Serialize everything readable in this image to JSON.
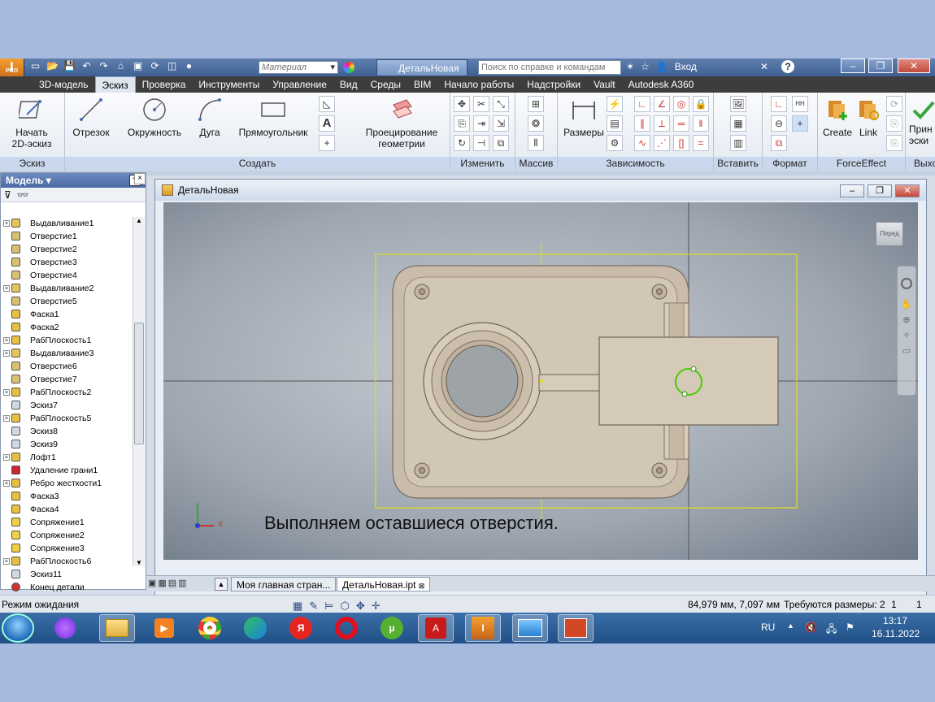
{
  "app": {
    "logo": "I",
    "logo_sub": "PRO"
  },
  "titlebar": {
    "material_placeholder": "Материал",
    "document_tab": "ДетальНовая",
    "search_placeholder": "Поиск по справке и командам",
    "login_label": "Вход"
  },
  "menu": {
    "tabs": [
      "3D-модель",
      "Эскиз",
      "Проверка",
      "Инструменты",
      "Управление",
      "Вид",
      "Среды",
      "BIM",
      "Начало работы",
      "Надстройки",
      "Vault",
      "Autodesk A360"
    ],
    "active_index": 1
  },
  "ribbon": {
    "start_sketch": {
      "line1": "Начать",
      "line2": "2D-эскиз"
    },
    "line": "Отрезок",
    "circle": "Окружность",
    "arc": "Дуга",
    "rectangle": "Прямоугольник",
    "project": {
      "line1": "Проецирование",
      "line2": "геометрии"
    },
    "dimension": "Размеры",
    "create": "Create",
    "link": "Link",
    "finish": {
      "line1": "Прин",
      "line2": "эски"
    },
    "panels": {
      "sketch": "Эскиз",
      "create": "Создать",
      "modify": "Изменить",
      "pattern": "Массив",
      "constrain": "Зависимость",
      "insert": "Вставить",
      "format": "Формат",
      "forceeffect": "ForceEffect",
      "exit": "Выхо"
    }
  },
  "browser": {
    "title": "Модель",
    "items": [
      {
        "label": "Выдавливание1",
        "icon": "extrude",
        "exp": true
      },
      {
        "label": "Отверстие1",
        "icon": "hole",
        "exp": false
      },
      {
        "label": "Отверстие2",
        "icon": "hole",
        "exp": false
      },
      {
        "label": "Отверстие3",
        "icon": "hole",
        "exp": false
      },
      {
        "label": "Отверстие4",
        "icon": "hole",
        "exp": false
      },
      {
        "label": "Выдавливание2",
        "icon": "extrude",
        "exp": true
      },
      {
        "label": "Отверстие5",
        "icon": "hole",
        "exp": false
      },
      {
        "label": "Фаска1",
        "icon": "chamfer",
        "exp": false
      },
      {
        "label": "Фаска2",
        "icon": "chamfer",
        "exp": false
      },
      {
        "label": "РабПлоскость1",
        "icon": "plane",
        "exp": true
      },
      {
        "label": "Выдавливание3",
        "icon": "extrude",
        "exp": true
      },
      {
        "label": "Отверстие6",
        "icon": "hole",
        "exp": false
      },
      {
        "label": "Отверстие7",
        "icon": "hole",
        "exp": false
      },
      {
        "label": "РабПлоскость2",
        "icon": "plane",
        "exp": true
      },
      {
        "label": "Эскиз7",
        "icon": "sketch",
        "exp": false
      },
      {
        "label": "РабПлоскость5",
        "icon": "plane",
        "exp": true
      },
      {
        "label": "Эскиз8",
        "icon": "sketch",
        "exp": false
      },
      {
        "label": "Эскиз9",
        "icon": "sketch",
        "exp": false
      },
      {
        "label": "Лофт1",
        "icon": "loft",
        "exp": true
      },
      {
        "label": "Удаление грани1",
        "icon": "delface",
        "exp": false
      },
      {
        "label": "Ребро жесткости1",
        "icon": "rib",
        "exp": true
      },
      {
        "label": "Фаска3",
        "icon": "chamfer",
        "exp": false
      },
      {
        "label": "Фаска4",
        "icon": "chamfer",
        "exp": false
      },
      {
        "label": "Сопряжение1",
        "icon": "fillet",
        "exp": false
      },
      {
        "label": "Сопряжение2",
        "icon": "fillet",
        "exp": false
      },
      {
        "label": "Сопряжение3",
        "icon": "fillet",
        "exp": false
      },
      {
        "label": "РабПлоскость6",
        "icon": "plane",
        "exp": true
      },
      {
        "label": "Эскиз11",
        "icon": "sketch",
        "exp": false
      },
      {
        "label": "Конец детали",
        "icon": "end",
        "exp": false
      }
    ]
  },
  "viewport": {
    "title": "ДетальНовая",
    "viewcube_label": "Перед",
    "axis_x": "X",
    "caption": "Выполняем оставшиеся отверстия."
  },
  "doc_tabs": [
    "Моя главная стран...",
    "ДетальНовая.ipt"
  ],
  "status": {
    "left": "Режим ожидания",
    "coords": "84,979 мм, 7,097 мм",
    "dims": "Требуются размеры: 2",
    "c1": "1",
    "c2": "1"
  },
  "taskbar": {
    "lang": "RU",
    "time": "13:17",
    "date": "16.11.2022"
  }
}
